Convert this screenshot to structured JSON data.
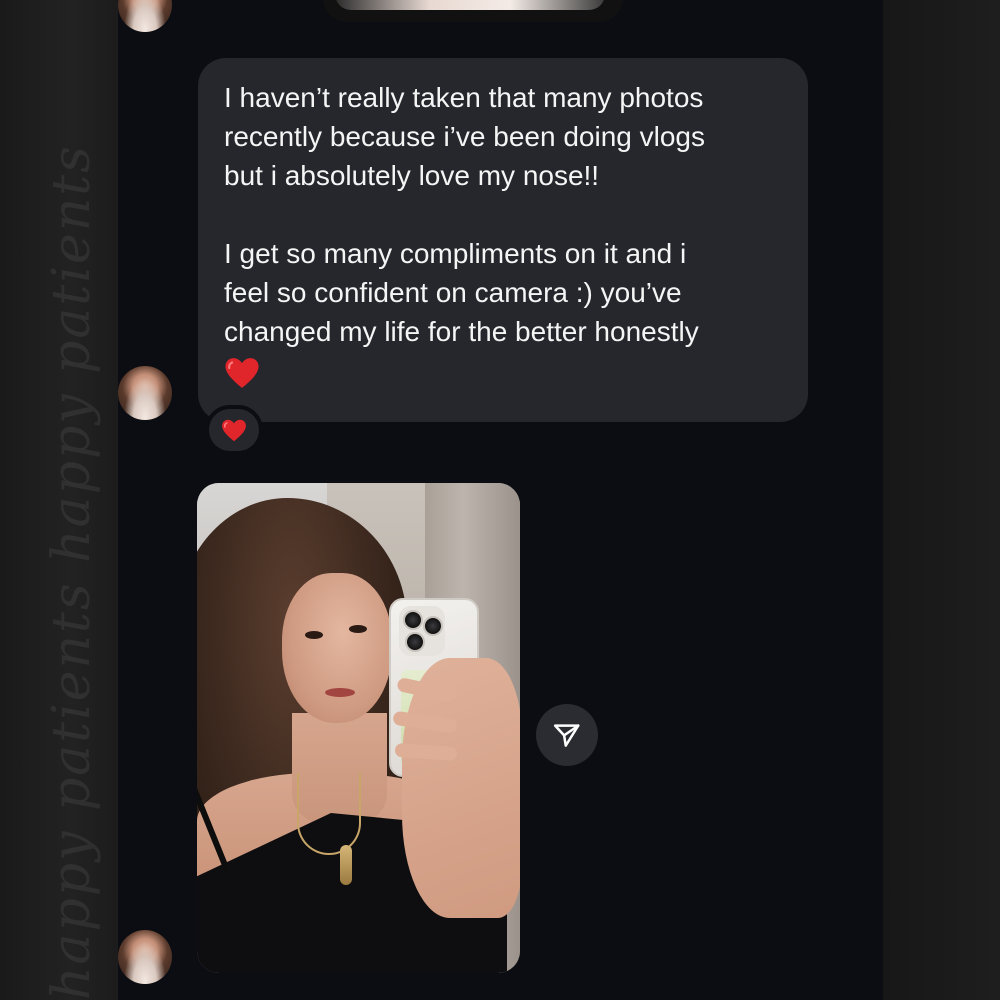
{
  "watermark": {
    "text": "happy patients happy patients"
  },
  "thread": {
    "message": {
      "paragraph1": "I haven’t really taken that many photos\nrecently because i’ve been doing vlogs\nbut i absolutely love my nose!!",
      "paragraph2": "I get so many compliments on it and i\nfeel so confident on camera :) you’ve\nchanged my life for the better honestly",
      "trailing_emoji": "heart-icon"
    },
    "reaction": {
      "emoji": "heart-icon"
    },
    "photo": {
      "description_icon": "mirror-selfie-photo"
    },
    "share_button": {
      "icon": "paper-plane-icon"
    }
  },
  "colors": {
    "chat_background": "#0b0d12",
    "bubble_background": "#25272d",
    "bubble_text": "#f5f5f5",
    "heart": "#e0252b",
    "share_button_background": "#2a2c31"
  }
}
